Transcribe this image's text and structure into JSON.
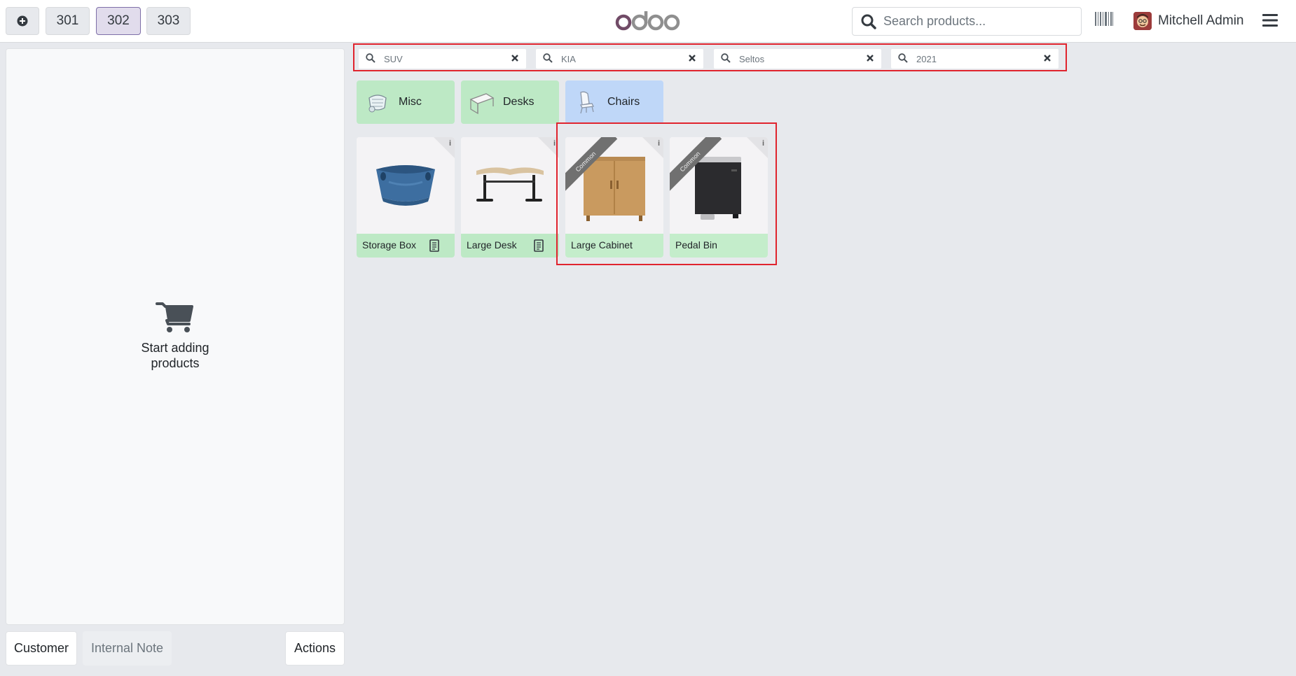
{
  "header": {
    "add_icon": "plus-circle-icon",
    "tabs": [
      {
        "label": "301",
        "active": false
      },
      {
        "label": "302",
        "active": true
      },
      {
        "label": "303",
        "active": false
      }
    ],
    "logo": "odoo",
    "search": {
      "placeholder": "Search products..."
    },
    "user": {
      "name": "Mitchell Admin"
    }
  },
  "order": {
    "empty_text": "Start adding products",
    "buttons": {
      "customer": "Customer",
      "internal_note": "Internal Note",
      "actions": "Actions"
    }
  },
  "filters": [
    {
      "value": "SUV"
    },
    {
      "value": "KIA"
    },
    {
      "value": "Seltos"
    },
    {
      "value": "2021"
    }
  ],
  "categories": [
    {
      "label": "Misc"
    },
    {
      "label": "Desks"
    },
    {
      "label": "Chairs",
      "selected": true
    }
  ],
  "products": [
    {
      "name": "Storage Box",
      "ribbon": ""
    },
    {
      "name": "Large Desk",
      "ribbon": ""
    },
    {
      "name": "Large Cabinet",
      "ribbon": "Common"
    },
    {
      "name": "Pedal Bin",
      "ribbon": "Common"
    }
  ],
  "colors": {
    "accent": "#714b67",
    "category_green": "#bde9c5",
    "category_blue": "#bfd7f8",
    "highlight": "#e0242e"
  }
}
